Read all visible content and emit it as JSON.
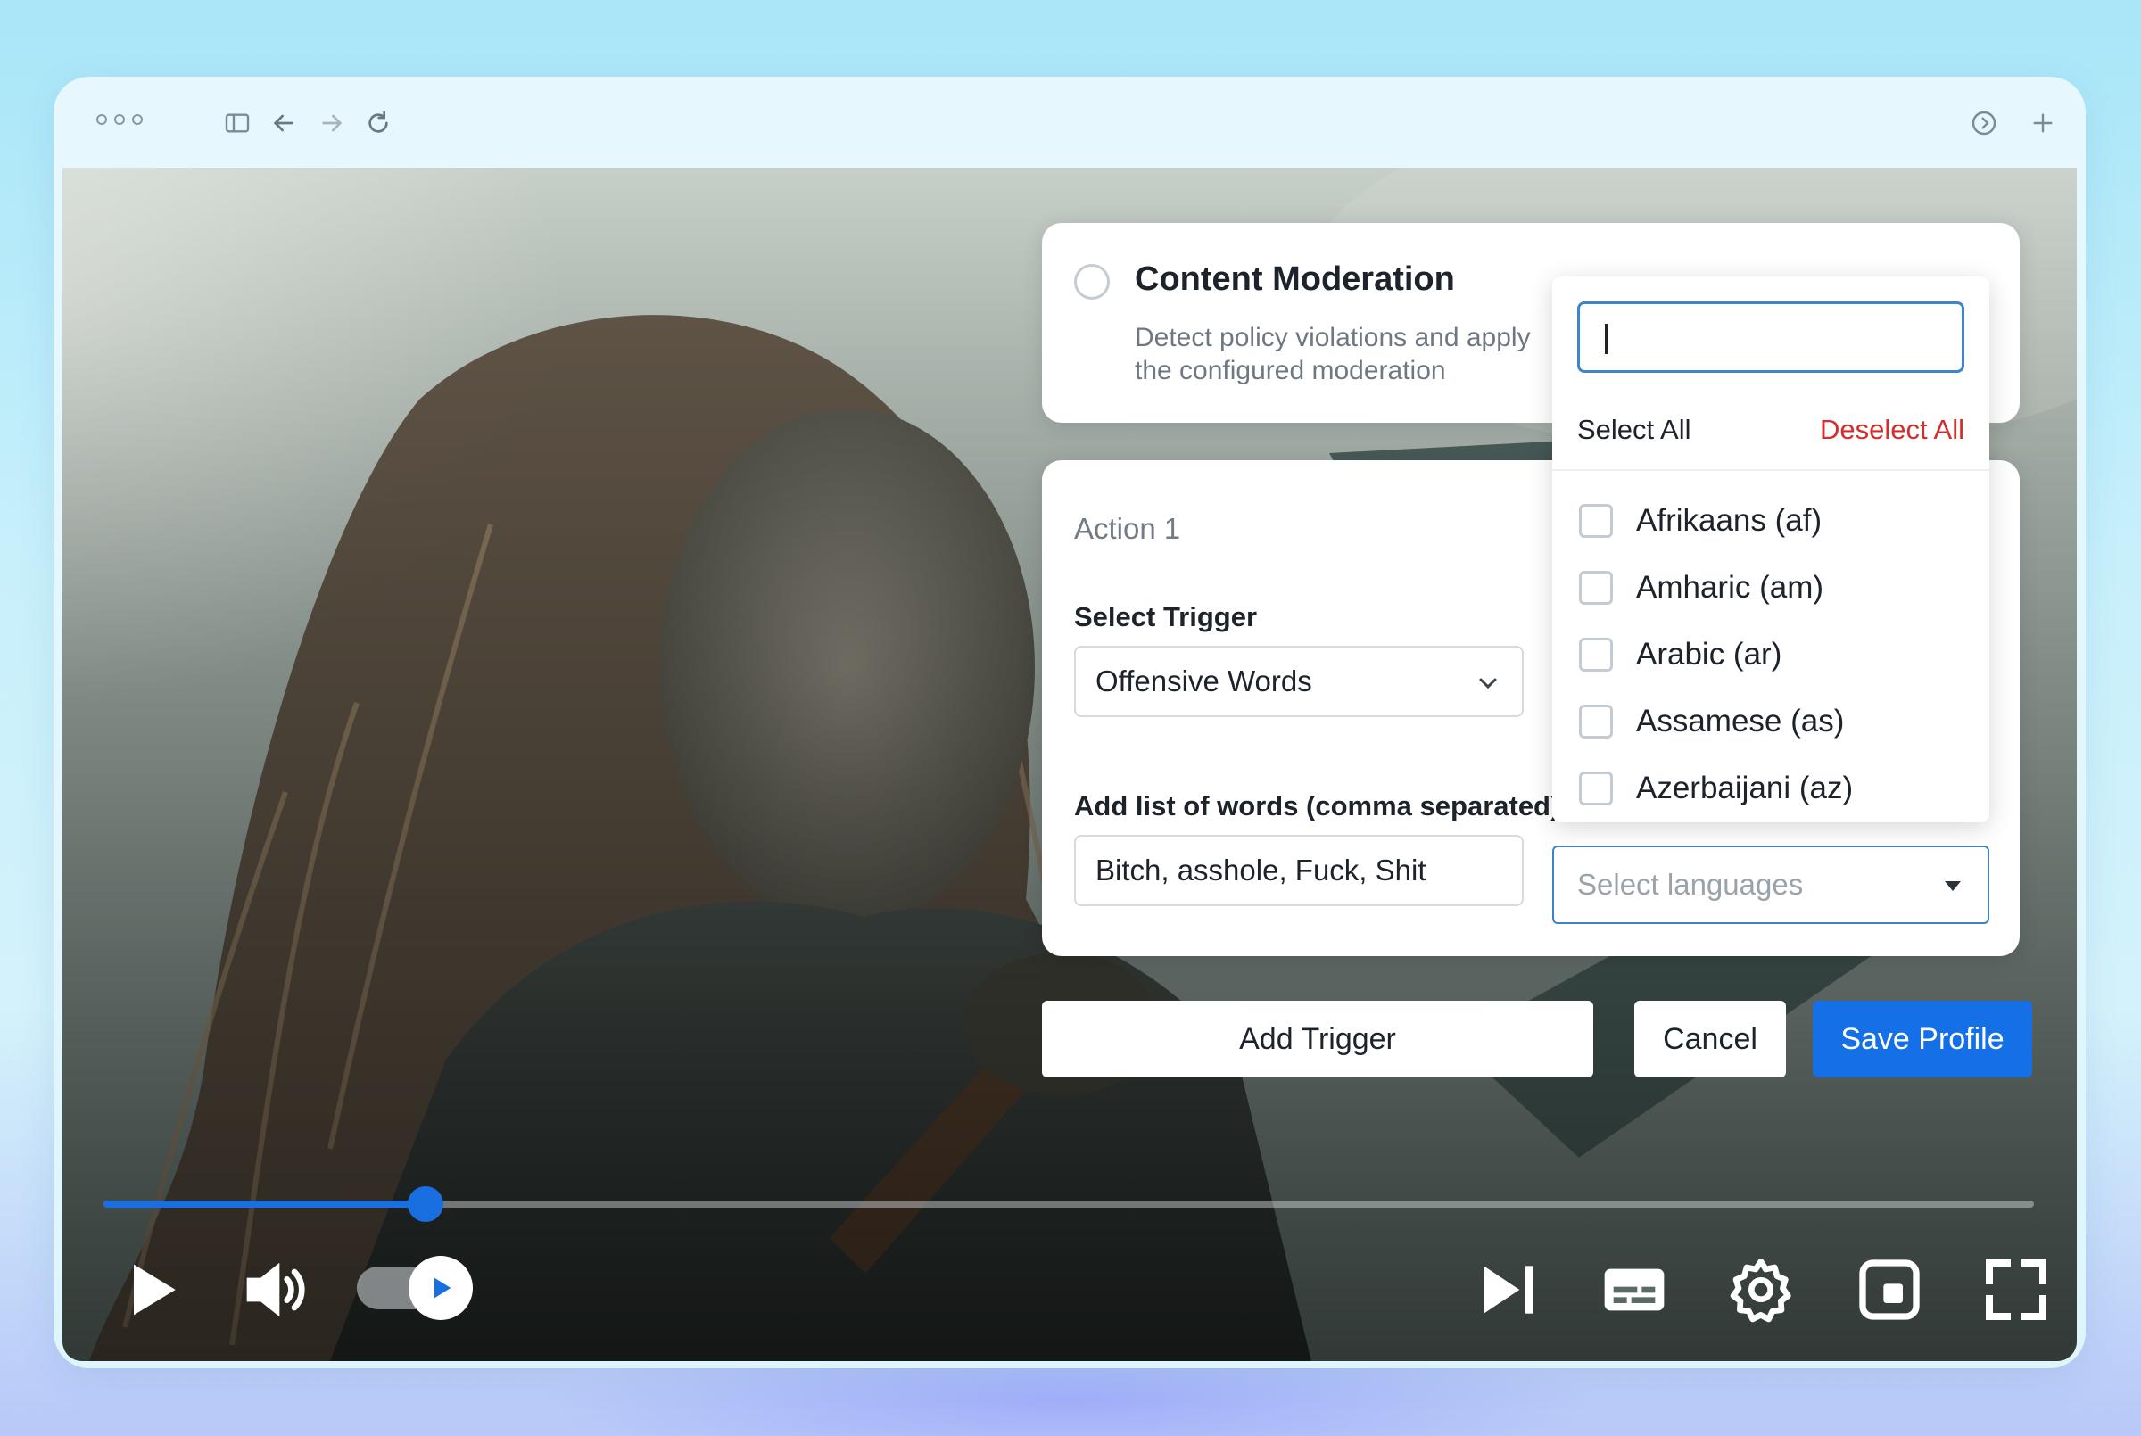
{
  "browser": {
    "sidebar_icon": "sidebar-icon",
    "back_icon": "arrow-left-icon",
    "forward_icon": "arrow-right-icon",
    "reload_icon": "reload-icon",
    "share_icon": "circle-arrow-icon",
    "new_tab_icon": "plus-icon"
  },
  "content_moderation": {
    "title": "Content Moderation",
    "description": "Detect policy violations and apply the configured moderation"
  },
  "action": {
    "title": "Action 1",
    "trigger_label": "Select Trigger",
    "trigger_value": "Offensive Words",
    "words_label": "Add list of words (comma separated)",
    "words_value": "Bitch, asshole, Fuck, Shit",
    "languages_placeholder": "Select languages"
  },
  "language_dropdown": {
    "search_value": "",
    "select_all": "Select All",
    "deselect_all": "Deselect All",
    "options": [
      {
        "label": "Afrikaans (af)",
        "checked": false
      },
      {
        "label": "Amharic (am)",
        "checked": false
      },
      {
        "label": "Arabic (ar)",
        "checked": false
      },
      {
        "label": "Assamese (as)",
        "checked": false
      },
      {
        "label": "Azerbaijani (az)",
        "checked": false
      }
    ]
  },
  "buttons": {
    "add_trigger": "Add Trigger",
    "cancel": "Cancel",
    "save_profile": "Save Profile"
  },
  "player": {
    "progress": 0.167,
    "accent": "#1a6fe0",
    "icons": [
      "play-icon",
      "volume-icon",
      "autoplay-toggle",
      "skip-next-icon",
      "subtitles-icon",
      "settings-icon",
      "miniplayer-icon",
      "fullscreen-icon"
    ]
  },
  "colors": {
    "primary": "#1570e8",
    "danger": "#d62c2c",
    "focus_border": "#3d86cf"
  }
}
